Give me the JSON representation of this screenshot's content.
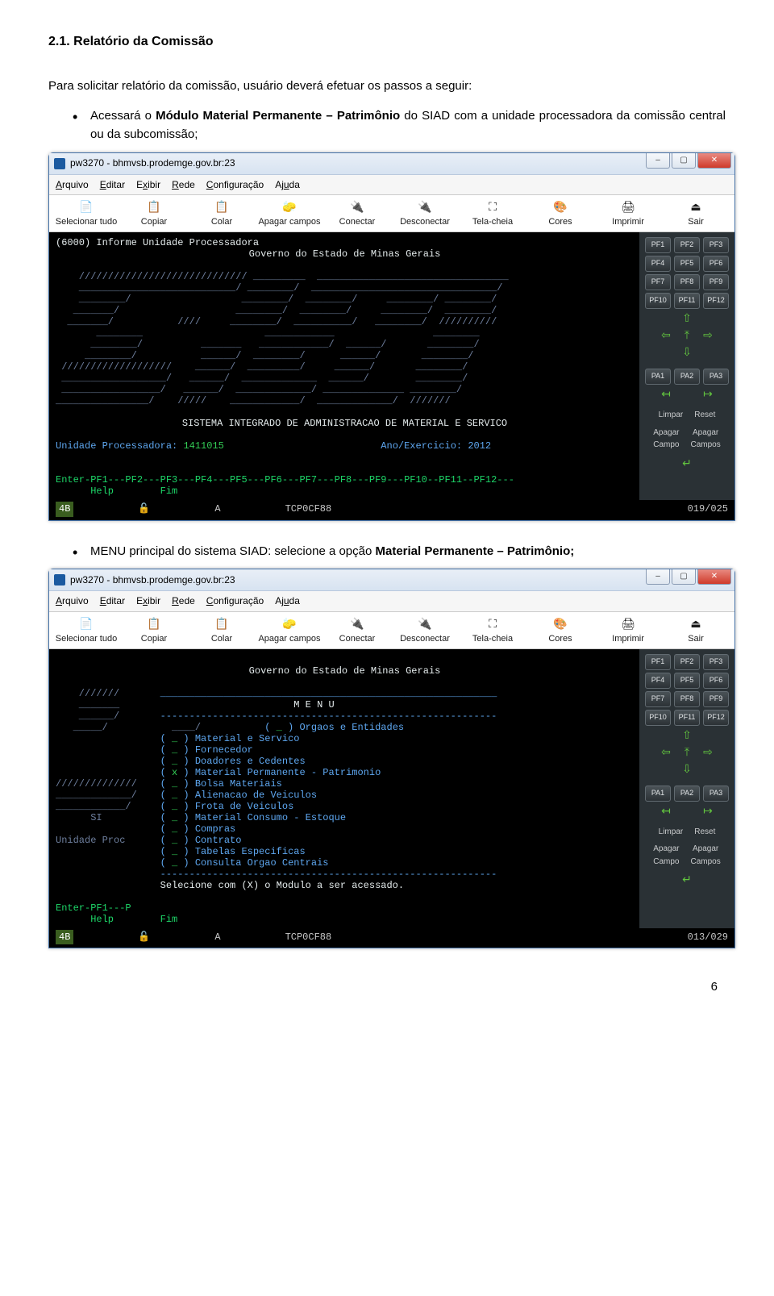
{
  "doc": {
    "heading": "2.1. Relatório da Comissão",
    "intro": "Para solicitar relatório da comissão, usuário deverá efetuar os passos a seguir:",
    "bullet1_pre": "Acessará o ",
    "bullet1_bold": "Módulo Material Permanente – Patrimônio",
    "bullet1_post": " do SIAD com a unidade processadora da comissão central ou da subcomissão;",
    "bullet2_pre": "MENU principal do sistema SIAD: selecione a opção ",
    "bullet2_bold": "Material Permanente – Patrimônio;",
    "page_number": "6"
  },
  "window": {
    "title": "pw3270 - bhmvsb.prodemge.gov.br:23",
    "buttons": {
      "min": "–",
      "max": "▢",
      "close": "✕"
    },
    "menus": [
      "Arquivo",
      "Editar",
      "Exibir",
      "Rede",
      "Configuração",
      "Ajuda"
    ],
    "toolbar": [
      {
        "icon": "📄",
        "label": "Selecionar tudo"
      },
      {
        "icon": "📋",
        "label": "Copiar"
      },
      {
        "icon": "📋",
        "label": "Colar"
      },
      {
        "icon": "🧽",
        "label": "Apagar campos"
      },
      {
        "icon": "🔌",
        "label": "Conectar"
      },
      {
        "icon": "🔌",
        "label": "Desconectar"
      },
      {
        "icon": "⛶",
        "label": "Tela-cheia"
      },
      {
        "icon": "🎨",
        "label": "Cores"
      },
      {
        "icon": "🖨",
        "label": "Imprimir"
      },
      {
        "icon": "⏏",
        "label": "Sair"
      }
    ],
    "rpanel": {
      "pf": [
        "PF1",
        "PF2",
        "PF3",
        "PF4",
        "PF5",
        "PF6",
        "PF7",
        "PF8",
        "PF9",
        "PF10",
        "PF11",
        "PF12"
      ],
      "pa": [
        "PA1",
        "PA2",
        "PA3"
      ],
      "labels": {
        "limpar": "Limpar",
        "reset": "Reset",
        "apagar_campo": "Apagar Campo",
        "apagar_campos": "Apagar Campos"
      }
    }
  },
  "term1": {
    "top": "(6000) Informe Unidade Processadora",
    "gov": "Governo do Estado de Minas Gerais",
    "sys": "SISTEMA INTEGRADO DE ADMINISTRACAO DE MATERIAL E SERVICO",
    "unidade_lbl": "Unidade Processadora:",
    "unidade_val": "1411015",
    "ano_lbl": "Ano/Exercicio:",
    "ano_val": "2012",
    "pfline": "Enter-PF1---PF2---PF3---PF4---PF5---PF6---PF7---PF8---PF9---PF10--PF11--PF12---",
    "help": "      Help        Fim",
    "status_left": "4B",
    "status_lock": "🔓",
    "status_a": "A",
    "status_tcp": "TCP0CF88",
    "status_pos": "019/025"
  },
  "term2": {
    "gov": "Governo do Estado de Minas Gerais",
    "menu_title": "M E N U",
    "menu": [
      {
        "mark": "_",
        "text": "Orgaos e Entidades"
      },
      {
        "mark": "_",
        "text": "Material e Servico"
      },
      {
        "mark": "_",
        "text": "Fornecedor"
      },
      {
        "mark": "_",
        "text": "Doadores e Cedentes"
      },
      {
        "mark": "x",
        "text": "Material Permanente - Patrimonio"
      },
      {
        "mark": "_",
        "text": "Bolsa Materiais"
      },
      {
        "mark": "_",
        "text": "Alienacao de Veiculos"
      },
      {
        "mark": "_",
        "text": "Frota de Veiculos"
      },
      {
        "mark": "_",
        "text": "Material Consumo - Estoque"
      },
      {
        "mark": "_",
        "text": "Compras"
      },
      {
        "mark": "_",
        "text": "Contrato"
      },
      {
        "mark": "_",
        "text": "Tabelas Especificas"
      },
      {
        "mark": "_",
        "text": "Consulta Orgao Centrais"
      }
    ],
    "si": "      SI",
    "uproc": "Unidade Proc",
    "sel": "Selecione com (X) o Modulo a ser acessado.",
    "pfline": "Enter-PF1---P",
    "help": "      Help        Fim",
    "status_left": "4B",
    "status_lock": "🔓",
    "status_a": "A",
    "status_tcp": "TCP0CF88",
    "status_pos": "013/029"
  }
}
